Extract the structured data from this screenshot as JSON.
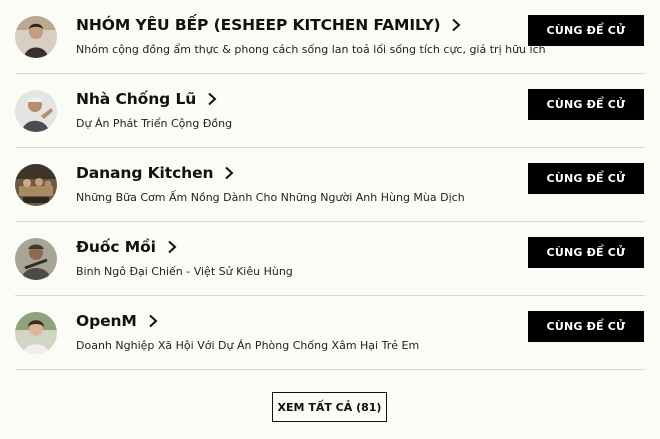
{
  "pages": [
    {
      "name": "NHÓM YÊU BẾP (ESHEEP KITCHEN FAMILY)",
      "description": "Nhóm cộng đồng ẩm thực & phong cách sống lan toả lối sống tích cực, giá trị hữu ích",
      "button_label": "CÙNG ĐỂ CỬ",
      "avatar_icon": "avatar-person-icon"
    },
    {
      "name": "Nhà Chống Lũ",
      "description": "Dự Án Phát Triển Cộng Đồng",
      "button_label": "CÙNG ĐỂ CỬ",
      "avatar_icon": "avatar-person-icon"
    },
    {
      "name": "Danang Kitchen",
      "description": "Những Bữa Cơm Ấm Nồng Dành Cho Những Người Anh Hùng Mùa Dịch",
      "button_label": "CÙNG ĐỂ CỬ",
      "avatar_icon": "avatar-kitchen-icon"
    },
    {
      "name": "Đuốc Mồi",
      "description": "Binh Ngô Đại Chiến - Việt Sử Kiêu Hùng",
      "button_label": "CÙNG ĐỂ CỬ",
      "avatar_icon": "avatar-person-icon"
    },
    {
      "name": "OpenM",
      "description": "Doanh Nghiệp Xã Hội Với Dự Án Phòng Chống Xâm Hại Trẻ Em",
      "button_label": "CÙNG ĐỂ CỬ",
      "avatar_icon": "avatar-person-icon"
    }
  ],
  "see_all_label": "XEM TẤT CẢ (81)",
  "colors": {
    "background": "#fcfcf7",
    "button": "#000000",
    "button_text": "#ffffff",
    "divider": "#d9d9d3"
  }
}
